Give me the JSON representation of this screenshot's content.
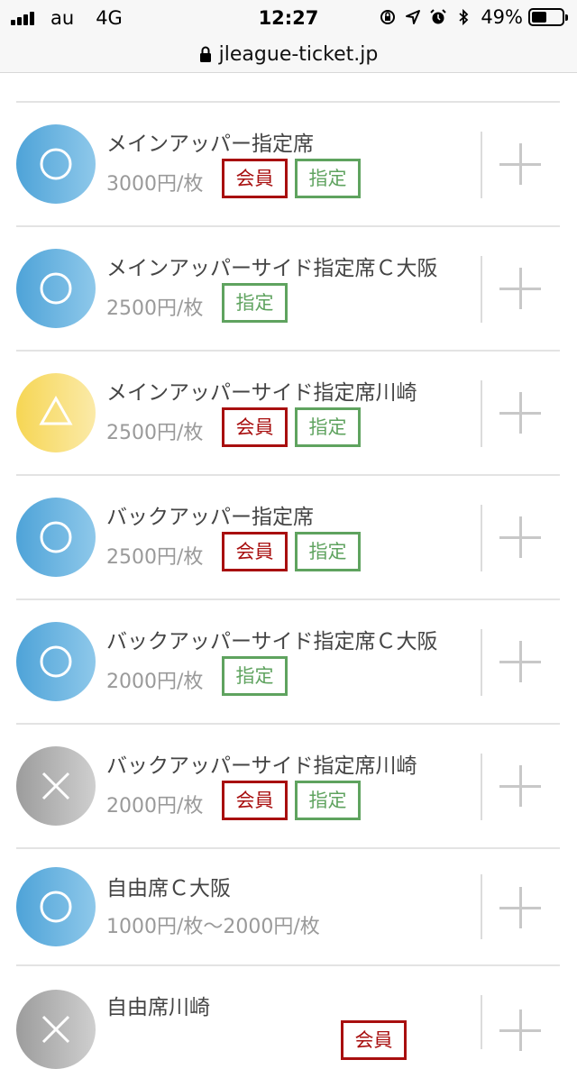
{
  "status": {
    "carrier": "au",
    "network": "4G",
    "time": "12:27",
    "battery": "49%",
    "battery_level": 0.49,
    "icons": [
      "orientation-lock-icon",
      "location-icon",
      "alarm-icon",
      "bluetooth-icon"
    ]
  },
  "browser": {
    "url": "jleague-ticket.jp"
  },
  "tags": {
    "member": "会員",
    "reserved": "指定"
  },
  "tickets": [
    {
      "name": "メインアッパー指定席",
      "price": "3000円/枚",
      "availability": "○",
      "member": true,
      "reserved": true
    },
    {
      "name": "メインアッパーサイド指定席Ｃ大阪",
      "price": "2500円/枚",
      "availability": "○",
      "member": false,
      "reserved": true
    },
    {
      "name": "メインアッパーサイド指定席川崎",
      "price": "2500円/枚",
      "availability": "△",
      "member": true,
      "reserved": true
    },
    {
      "name": "バックアッパー指定席",
      "price": "2500円/枚",
      "availability": "○",
      "member": true,
      "reserved": true
    },
    {
      "name": "バックアッパーサイド指定席Ｃ大阪",
      "price": "2000円/枚",
      "availability": "○",
      "member": false,
      "reserved": true
    },
    {
      "name": "バックアッパーサイド指定席川崎",
      "price": "2000円/枚",
      "availability": "×",
      "member": true,
      "reserved": true
    },
    {
      "name": "自由席Ｃ大阪",
      "price": "1000円/枚～2000円/枚",
      "availability": "○",
      "member": false,
      "reserved": false
    },
    {
      "name": "自由席川崎",
      "price": "",
      "availability": "×",
      "member": true,
      "reserved": false
    }
  ],
  "colors": {
    "available": "#4ea3d8",
    "few_left": "#f6d654",
    "sold_out": "#9c9c9c",
    "member_tag": "#a80f0f",
    "reserved_tag": "#5fa35f"
  }
}
